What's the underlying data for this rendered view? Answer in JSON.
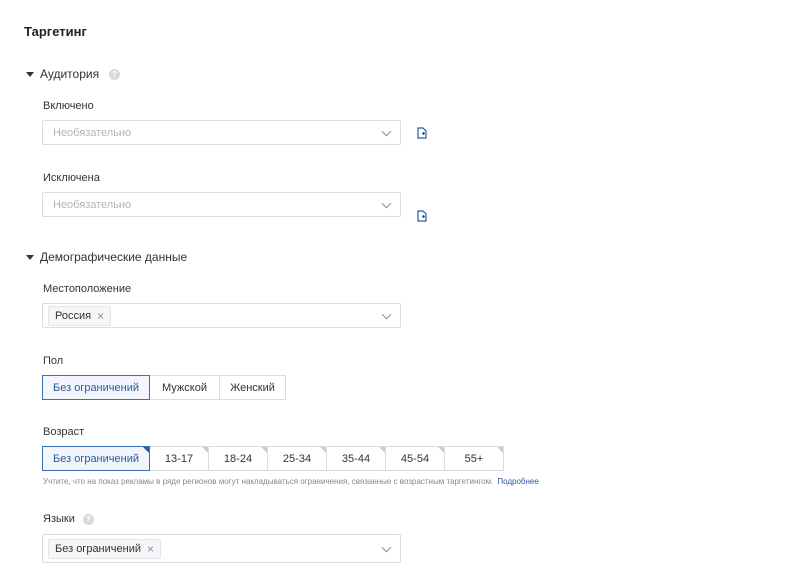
{
  "title": "Таргетинг",
  "audience": {
    "section_label": "Аудитория",
    "help_glyph": "?",
    "included": {
      "label": "Включено",
      "placeholder": "Необязательно"
    },
    "excluded": {
      "label": "Исключена",
      "placeholder": "Необязательно"
    }
  },
  "demographics": {
    "section_label": "Демографические данные",
    "location": {
      "label": "Местоположение",
      "chips": [
        "Россия"
      ]
    },
    "gender": {
      "label": "Пол",
      "options": [
        "Без ограничений",
        "Мужской",
        "Женский"
      ],
      "selected": "Без ограничений"
    },
    "age": {
      "label": "Возраст",
      "options": [
        "Без ограничений",
        "13-17",
        "18-24",
        "25-34",
        "35-44",
        "45-54",
        "55+"
      ],
      "selected": "Без ограничений",
      "note": "Учтите, что на показ рекламы в ряде регионов могут накладываться ограничения, связанные с возрастным таргетингом.",
      "note_link": "Подробнее"
    },
    "languages": {
      "label": "Языки",
      "help_glyph": "?",
      "chips": [
        "Без ограничений"
      ]
    }
  },
  "colors": {
    "accent": "#3b6fb6",
    "link": "#2b5a9e",
    "border": "#d9dde3"
  }
}
